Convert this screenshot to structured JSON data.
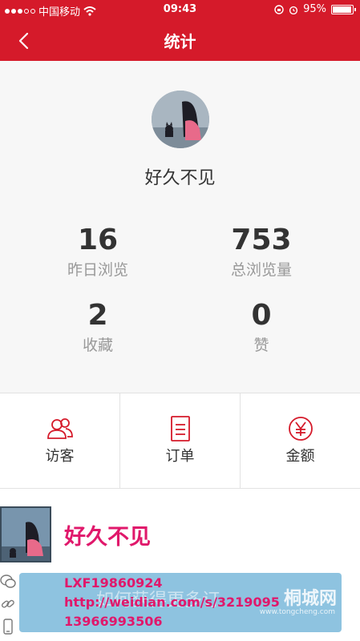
{
  "status_bar": {
    "carrier": "中国移动",
    "time": "09:43",
    "battery_text": "95%",
    "battery_level": 0.95
  },
  "nav": {
    "title": "统计",
    "back_icon": "chevron-left-icon"
  },
  "profile": {
    "name": "好久不见"
  },
  "stats": [
    {
      "value": "16",
      "label": "昨日浏览"
    },
    {
      "value": "753",
      "label": "总浏览量"
    },
    {
      "value": "2",
      "label": "收藏"
    },
    {
      "value": "0",
      "label": "赞"
    }
  ],
  "actions": [
    {
      "label": "访客",
      "icon": "visitors-icon"
    },
    {
      "label": "订单",
      "icon": "order-icon"
    },
    {
      "label": "金额",
      "icon": "yuan-icon"
    }
  ],
  "colors": {
    "brand_red": "#d51a2a",
    "pink_text": "#e0186b",
    "banner_blue": "#8ec3e0"
  },
  "ad": {
    "name": "好久不见",
    "lines": [
      "LXF19860924",
      "http://weidian.com/s/3219095",
      "13966993506"
    ],
    "watermark_left": "如何获得更多订",
    "watermark": "桐城网",
    "watermark_sub": "www.tongcheng.com"
  }
}
